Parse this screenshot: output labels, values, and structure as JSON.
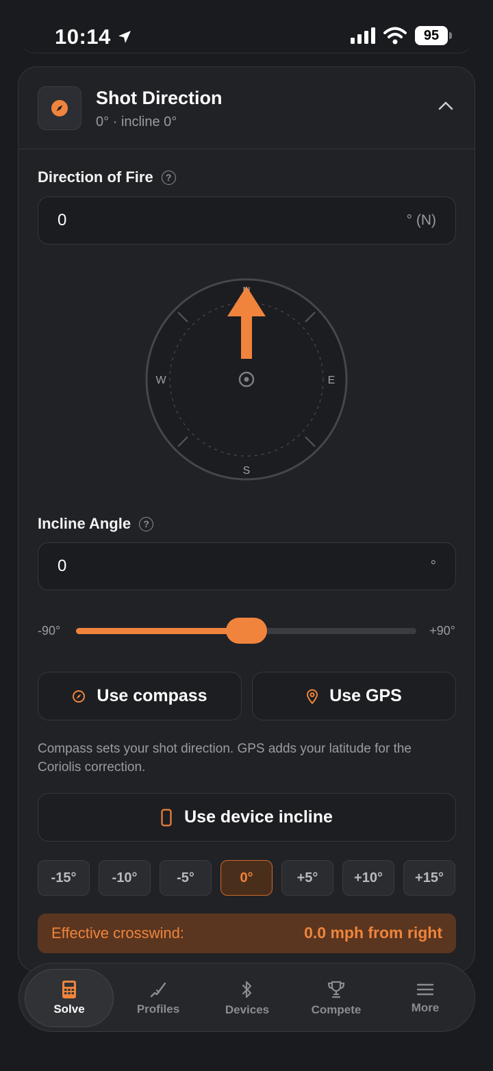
{
  "status_bar": {
    "time": "10:14",
    "battery": "95"
  },
  "header": {
    "title": "Shot Direction",
    "subtitle": "0° · incline 0°"
  },
  "direction": {
    "label": "Direction of Fire",
    "value": "0",
    "unit": "° (N)"
  },
  "compass": {
    "north": "N",
    "south": "S",
    "east": "E",
    "west": "W",
    "heading_deg": 0
  },
  "incline": {
    "label": "Incline Angle",
    "value": "0",
    "unit": "°"
  },
  "slider": {
    "min_label": "-90°",
    "max_label": "+90°",
    "min": -90,
    "max": 90,
    "value": 0
  },
  "buttons": {
    "compass_label": "Use compass",
    "gps_label": "Use GPS",
    "device_incline_label": "Use device incline"
  },
  "help_text": "Compass sets your shot direction. GPS adds your latitude for the Coriolis correction.",
  "incline_presets": [
    "-15°",
    "-10°",
    "-5°",
    "0°",
    "+5°",
    "+10°",
    "+15°"
  ],
  "incline_active_index": 3,
  "crosswind": {
    "label": "Effective crosswind:",
    "value": "0.0 mph from right"
  },
  "tabs": [
    {
      "label": "Solve",
      "icon": "calculator-icon"
    },
    {
      "label": "Profiles",
      "icon": "rifle-icon"
    },
    {
      "label": "Devices",
      "icon": "bluetooth-icon"
    },
    {
      "label": "Compete",
      "icon": "trophy-icon"
    },
    {
      "label": "More",
      "icon": "menu-icon"
    }
  ],
  "colors": {
    "accent": "#f0843c",
    "background": "#1a1b1e",
    "card": "#212226"
  }
}
